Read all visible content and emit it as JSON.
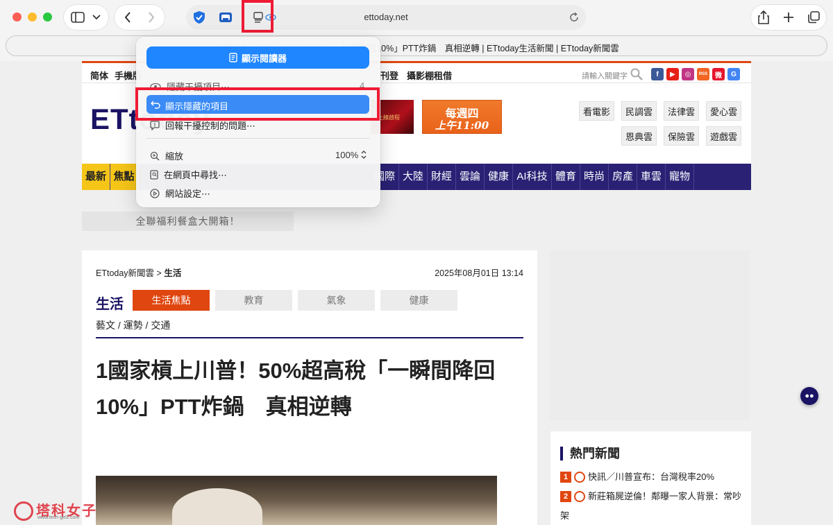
{
  "browser": {
    "url": "ettoday.net",
    "tab_title": "1國家槓上川普！50%超高稅「一瞬間降回10%」PTT炸鍋　真相逆轉 | ETtoday生活新聞 | ETtoday新聞雲"
  },
  "menu": {
    "reader_label": "顯示閱讀器",
    "hide_distracting_label": "隱藏干擾項目⋯",
    "hide_count": "4",
    "show_hidden_label": "顯示隱藏的項目",
    "report_label": "回報干擾控制的問題⋯",
    "zoom_label": "縮放",
    "zoom_value": "100%",
    "find_label": "在網頁中尋找⋯",
    "site_settings_label": "網站設定⋯"
  },
  "site": {
    "top_links": [
      "简体",
      "手機版",
      "刊登",
      "攝影棚租借"
    ],
    "search_placeholder": "請輸入關鍵字",
    "social": [
      "f",
      "▶",
      "◎",
      "RSS",
      "微",
      "G"
    ],
    "logo": "ETtoday",
    "ad1_text": "上線啟程",
    "ad2_line1": "每週四",
    "ad2_line2": "上午11:00",
    "clouds": [
      "看電影",
      "民調雲",
      "法律雲",
      "愛心雲",
      "恩典雲",
      "保險雲",
      "遊戲雲"
    ],
    "nav_left": [
      "最新",
      "焦點"
    ],
    "nav": [
      "國際",
      "大陸",
      "財經",
      "雲論",
      "健康",
      "AI科技",
      "體育",
      "時尚",
      "房產",
      "車雲",
      "寵物"
    ],
    "promo": "全聯福利餐盒大開箱！"
  },
  "article": {
    "breadcrumb_root": "ETtoday新聞雲 > ",
    "breadcrumb_current": "生活",
    "datetime": "2025年08月01日 13:14",
    "section": "生活",
    "tabs": [
      "生活焦點",
      "教育",
      "氣象",
      "健康"
    ],
    "subnav": "藝文 / 運勢 / 交通",
    "headline_line1": "1國家槓上川普！50%超高稅「一瞬間降回",
    "headline_line2": "10%」PTT炸鍋　真相逆轉"
  },
  "hot_news": {
    "title": "熱門新聞",
    "items": [
      {
        "rank": "1",
        "text": "快訊／川普宣布：台灣稅率20%"
      },
      {
        "rank": "2",
        "text": "新莊箱屍逆倫！鄰曝一家人背景：常吵架"
      }
    ]
  },
  "watermark": {
    "brand": "塔科女子",
    "url": "www.tech-girlz.com"
  },
  "colors": {
    "accent_blue": "#1f86ff",
    "highlight_red": "#ef1b35",
    "site_navy": "#2a2175",
    "site_orange": "#e0460f"
  }
}
